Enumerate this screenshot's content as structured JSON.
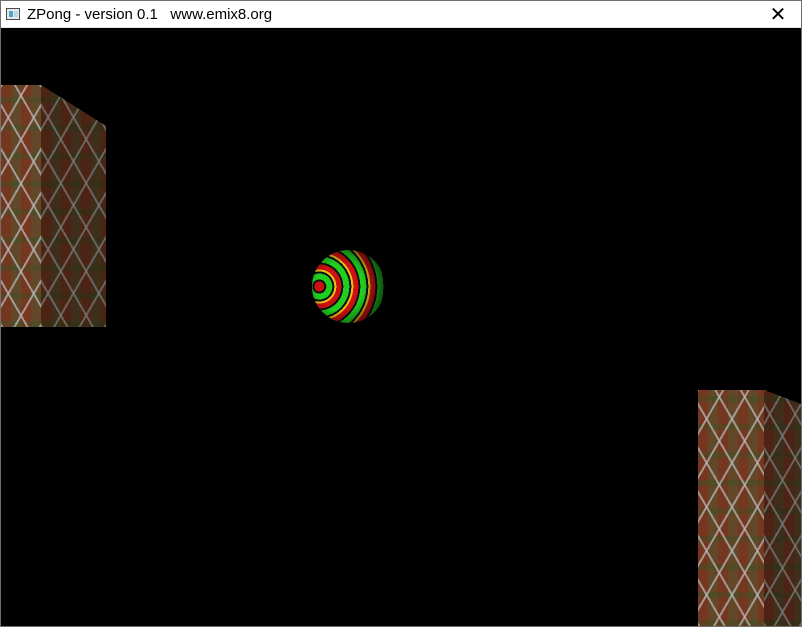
{
  "window": {
    "title": "ZPong - version 0.1   www.emix8.org",
    "close_symbol": "✕"
  },
  "scene": {
    "background": "#000000",
    "texture_colors": [
      "#7a3a22",
      "#d7d7d7",
      "#3c6428",
      "#6e6e3c"
    ],
    "ball_colors": [
      "#cf1010",
      "#20d020",
      "#e6c018"
    ]
  }
}
